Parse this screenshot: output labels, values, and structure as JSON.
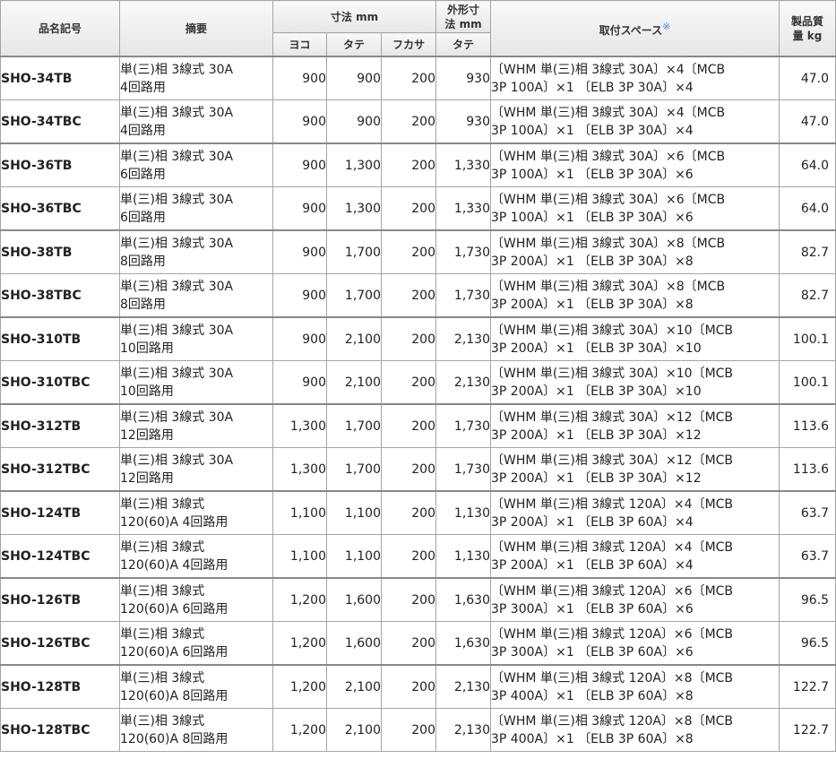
{
  "headers": {
    "model": "品名記号",
    "summary": "摘要",
    "dimensions": "寸法 mm",
    "outer": "外形寸法 mm",
    "mount_space": "取付スペース",
    "mount_mark": "※",
    "weight": "製品質量 kg",
    "yoko": "ヨコ",
    "tate": "タテ",
    "fukasa": "フカサ",
    "outer_tate": "タテ"
  },
  "rows": [
    {
      "model": "SHO-34TB",
      "summary_1": "単(三)相 3線式 30A",
      "summary_2": "4回路用",
      "yoko": "900",
      "tate": "900",
      "fukasa": "200",
      "outer": "930",
      "space_1": "〔WHM 単(三)相 3線式 30A〕×4〔MCB",
      "space_2": "3P 100A〕×1 〔ELB 3P 30A〕×4",
      "weight": "47.0"
    },
    {
      "model": "SHO-34TBC",
      "summary_1": "単(三)相 3線式 30A",
      "summary_2": "4回路用",
      "yoko": "900",
      "tate": "900",
      "fukasa": "200",
      "outer": "930",
      "space_1": "〔WHM 単(三)相 3線式 30A〕×4〔MCB",
      "space_2": "3P 100A〕×1 〔ELB 3P 30A〕×4",
      "weight": "47.0"
    },
    {
      "model": "SHO-36TB",
      "summary_1": "単(三)相 3線式 30A",
      "summary_2": "6回路用",
      "yoko": "900",
      "tate": "1,300",
      "fukasa": "200",
      "outer": "1,330",
      "space_1": "〔WHM 単(三)相 3線式 30A〕×6〔MCB",
      "space_2": "3P 100A〕×1 〔ELB 3P 30A〕×6",
      "weight": "64.0"
    },
    {
      "model": "SHO-36TBC",
      "summary_1": "単(三)相 3線式 30A",
      "summary_2": "6回路用",
      "yoko": "900",
      "tate": "1,300",
      "fukasa": "200",
      "outer": "1,330",
      "space_1": "〔WHM 単(三)相 3線式 30A〕×6〔MCB",
      "space_2": "3P 100A〕×1 〔ELB 3P 30A〕×6",
      "weight": "64.0"
    },
    {
      "model": "SHO-38TB",
      "summary_1": "単(三)相 3線式 30A",
      "summary_2": "8回路用",
      "yoko": "900",
      "tate": "1,700",
      "fukasa": "200",
      "outer": "1,730",
      "space_1": "〔WHM 単(三)相 3線式 30A〕×8〔MCB",
      "space_2": "3P 200A〕×1 〔ELB 3P 30A〕×8",
      "weight": "82.7"
    },
    {
      "model": "SHO-38TBC",
      "summary_1": "単(三)相 3線式 30A",
      "summary_2": "8回路用",
      "yoko": "900",
      "tate": "1,700",
      "fukasa": "200",
      "outer": "1,730",
      "space_1": "〔WHM 単(三)相 3線式 30A〕×8〔MCB",
      "space_2": "3P 200A〕×1 〔ELB 3P 30A〕×8",
      "weight": "82.7"
    },
    {
      "model": "SHO-310TB",
      "summary_1": "単(三)相 3線式 30A",
      "summary_2": "10回路用",
      "yoko": "900",
      "tate": "2,100",
      "fukasa": "200",
      "outer": "2,130",
      "space_1": "〔WHM 単(三)相 3線式 30A〕×10〔MCB",
      "space_2": "3P 200A〕×1 〔ELB 3P 30A〕×10",
      "weight": "100.1"
    },
    {
      "model": "SHO-310TBC",
      "summary_1": "単(三)相 3線式 30A",
      "summary_2": "10回路用",
      "yoko": "900",
      "tate": "2,100",
      "fukasa": "200",
      "outer": "2,130",
      "space_1": "〔WHM 単(三)相 3線式 30A〕×10〔MCB",
      "space_2": "3P 200A〕×1 〔ELB 3P 30A〕×10",
      "weight": "100.1"
    },
    {
      "model": "SHO-312TB",
      "summary_1": "単(三)相 3線式 30A",
      "summary_2": "12回路用",
      "yoko": "1,300",
      "tate": "1,700",
      "fukasa": "200",
      "outer": "1,730",
      "space_1": "〔WHM 単(三)相 3線式 30A〕×12〔MCB",
      "space_2": "3P 200A〕×1 〔ELB 3P 30A〕×12",
      "weight": "113.6"
    },
    {
      "model": "SHO-312TBC",
      "summary_1": "単(三)相 3線式 30A",
      "summary_2": "12回路用",
      "yoko": "1,300",
      "tate": "1,700",
      "fukasa": "200",
      "outer": "1,730",
      "space_1": "〔WHM 単(三)相 3線式 30A〕×12〔MCB",
      "space_2": "3P 200A〕×1 〔ELB 3P 30A〕×12",
      "weight": "113.6"
    },
    {
      "model": "SHO-124TB",
      "summary_1": "単(三)相 3線式",
      "summary_2": "120(60)A 4回路用",
      "yoko": "1,100",
      "tate": "1,100",
      "fukasa": "200",
      "outer": "1,130",
      "space_1": "〔WHM 単(三)相 3線式 120A〕×4〔MCB",
      "space_2": "3P 200A〕×1 〔ELB 3P 60A〕×4",
      "weight": "63.7"
    },
    {
      "model": "SHO-124TBC",
      "summary_1": "単(三)相 3線式",
      "summary_2": "120(60)A 4回路用",
      "yoko": "1,100",
      "tate": "1,100",
      "fukasa": "200",
      "outer": "1,130",
      "space_1": "〔WHM 単(三)相 3線式 120A〕×4〔MCB",
      "space_2": "3P 200A〕×1 〔ELB 3P 60A〕×4",
      "weight": "63.7"
    },
    {
      "model": "SHO-126TB",
      "summary_1": "単(三)相 3線式",
      "summary_2": "120(60)A 6回路用",
      "yoko": "1,200",
      "tate": "1,600",
      "fukasa": "200",
      "outer": "1,630",
      "space_1": "〔WHM 単(三)相 3線式 120A〕×6〔MCB",
      "space_2": "3P 300A〕×1 〔ELB 3P 60A〕×6",
      "weight": "96.5"
    },
    {
      "model": "SHO-126TBC",
      "summary_1": "単(三)相 3線式",
      "summary_2": "120(60)A 6回路用",
      "yoko": "1,200",
      "tate": "1,600",
      "fukasa": "200",
      "outer": "1,630",
      "space_1": "〔WHM 単(三)相 3線式 120A〕×6〔MCB",
      "space_2": "3P 300A〕×1 〔ELB 3P 60A〕×6",
      "weight": "96.5"
    },
    {
      "model": "SHO-128TB",
      "summary_1": "単(三)相 3線式",
      "summary_2": "120(60)A 8回路用",
      "yoko": "1,200",
      "tate": "2,100",
      "fukasa": "200",
      "outer": "2,130",
      "space_1": "〔WHM 単(三)相 3線式 120A〕×8〔MCB",
      "space_2": "3P 400A〕×1 〔ELB 3P 60A〕×8",
      "weight": "122.7"
    },
    {
      "model": "SHO-128TBC",
      "summary_1": "単(三)相 3線式",
      "summary_2": "120(60)A 8回路用",
      "yoko": "1,200",
      "tate": "2,100",
      "fukasa": "200",
      "outer": "2,130",
      "space_1": "〔WHM 単(三)相 3線式 120A〕×8〔MCB",
      "space_2": "3P 400A〕×1 〔ELB 3P 60A〕×8",
      "weight": "122.7"
    }
  ]
}
